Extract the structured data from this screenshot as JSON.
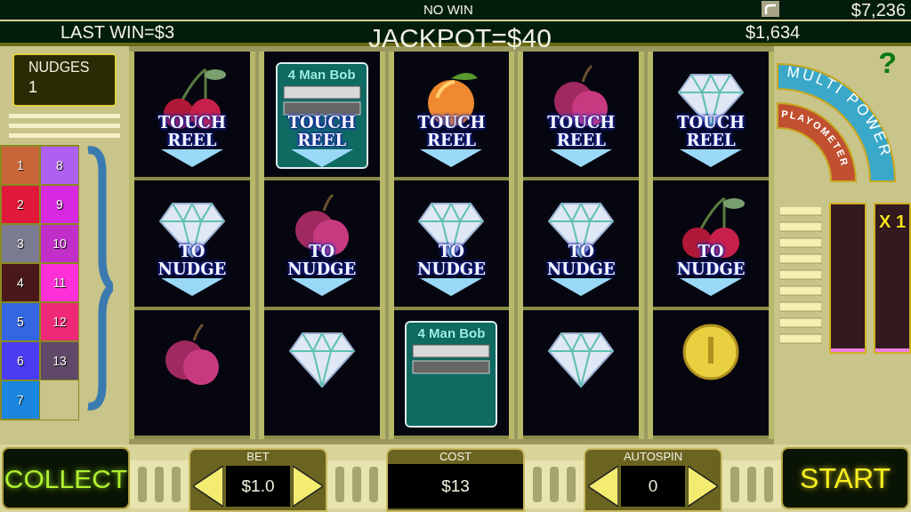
{
  "header": {
    "status": "NO WIN",
    "credit": "$7,236",
    "last_win": "LAST WIN=$3",
    "jackpot": "JACKPOT=$40",
    "bank": "$1,634"
  },
  "nudges": {
    "label": "NUDGES",
    "value": "1"
  },
  "paylines": [
    {
      "number": "1",
      "color": "#c8663a"
    },
    {
      "number": "2",
      "color": "#e0183a"
    },
    {
      "number": "3",
      "color": "#7a7a90"
    },
    {
      "number": "4",
      "color": "#4a1818"
    },
    {
      "number": "5",
      "color": "#3366e0"
    },
    {
      "number": "6",
      "color": "#4a3cf0"
    },
    {
      "number": "7",
      "color": "#1a86e0"
    },
    {
      "number": "8",
      "color": "#b060f0"
    },
    {
      "number": "9",
      "color": "#d828e0"
    },
    {
      "number": "10",
      "color": "#c030c8"
    },
    {
      "number": "11",
      "color": "#ff30d8"
    },
    {
      "number": "12",
      "color": "#f02878"
    },
    {
      "number": "13",
      "color": "#604868"
    }
  ],
  "reels": [
    {
      "symbols": [
        {
          "kind": "cherry"
        },
        {
          "kind": "diamond"
        },
        {
          "kind": "plum"
        }
      ],
      "hints": [
        "TOUCH REEL",
        "TO NUDGE"
      ]
    },
    {
      "symbols": [
        {
          "kind": "bob",
          "label": "4 Man Bob"
        },
        {
          "kind": "plum"
        },
        {
          "kind": "diamond"
        }
      ],
      "hints": [
        "TOUCH REEL",
        "TO NUDGE"
      ]
    },
    {
      "symbols": [
        {
          "kind": "peach"
        },
        {
          "kind": "diamond"
        },
        {
          "kind": "bob",
          "label": "4 Man Bob"
        }
      ],
      "hints": [
        "TOUCH REEL",
        "TO NUDGE"
      ]
    },
    {
      "symbols": [
        {
          "kind": "plum"
        },
        {
          "kind": "diamond"
        },
        {
          "kind": "diamond"
        }
      ],
      "hints": [
        "TOUCH REEL",
        "TO NUDGE"
      ]
    },
    {
      "symbols": [
        {
          "kind": "diamond"
        },
        {
          "kind": "cherry"
        },
        {
          "kind": "coin"
        }
      ],
      "hints": [
        "TOUCH REEL",
        "TO NUDGE"
      ]
    }
  ],
  "side": {
    "help": "?",
    "multi_power": {
      "label": "MULTI POWER",
      "level": 0,
      "multiplier": "X 1"
    },
    "playometer": {
      "label": "PLAYOMETER",
      "level": 0
    }
  },
  "controls": {
    "collect": "COLLECT",
    "bet": {
      "label": "BET",
      "value": "$1.0"
    },
    "cost": {
      "label": "COST",
      "value": "$13"
    },
    "autospin": {
      "label": "AUTOSPIN",
      "value": "0"
    },
    "start": "START"
  }
}
